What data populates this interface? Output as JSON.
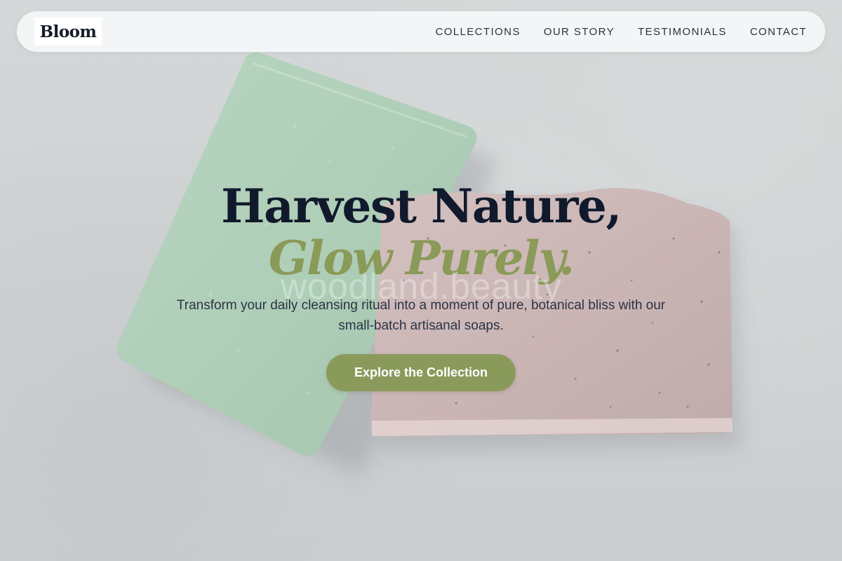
{
  "site": {
    "logo": "Bloom"
  },
  "nav": {
    "items": [
      {
        "label": "COLLECTIONS"
      },
      {
        "label": "OUR STORY"
      },
      {
        "label": "TESTIMONIALS"
      },
      {
        "label": "CONTACT"
      }
    ]
  },
  "hero": {
    "headline": "Harvest Nature,",
    "headline_accent": "Glow Purely.",
    "watermark": "woodland.beauty",
    "subtitle": "Transform your daily cleansing ritual into a moment of pure, botanical bliss with our small-batch artisanal soaps.",
    "cta_label": "Explore the Collection"
  },
  "colors": {
    "accent_green": "#8a9a5b",
    "headline_navy": "#111a2c",
    "nav_bar_bg": "#f5f7f8",
    "soap_sage": "#a9cdb3",
    "soap_rose": "#c8aeae",
    "background_stone": "#cbcecf"
  }
}
